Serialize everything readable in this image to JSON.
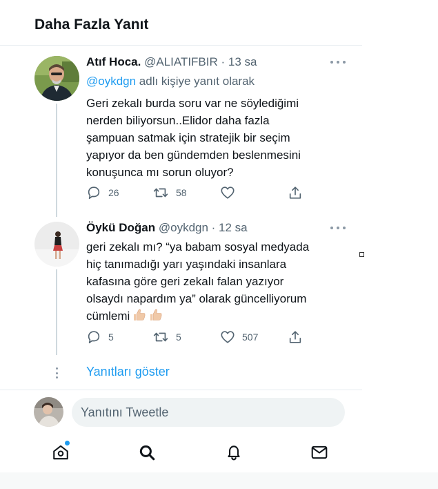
{
  "header": {
    "title": "Daha Fazla Yanıt"
  },
  "tweets": [
    {
      "name": "Atıf Hoca.",
      "meta": "@ALIATIFBIR · 13 sa",
      "reply_prefix": "@oykdgn",
      "reply_suffix": " adlı kişiye yanıt olarak",
      "lines": [
        "Geri zekalı burda soru var ne söylediğimi",
        "nerden biliyorsun..Elidor daha fazla",
        "şampuan satmak için stratejik bir seçim",
        "yapıyor da ben gündemden beslenmesini",
        "konuşunca mı sorun oluyor?"
      ],
      "replies": "26",
      "retweets": "58",
      "likes": ""
    },
    {
      "name": "Öykü Doğan",
      "meta": "@oykdgn · 12 sa",
      "lines": [
        "geri zekalı mı? “ya babam sosyal medyada",
        "hiç tanımadığı yarı yaşındaki insanlara",
        "kafasına göre geri zekalı falan yazıyor",
        "olsaydı napardım ya” olarak güncelliyorum",
        "cümlemi"
      ],
      "emoji": "thumbs-up-light-skin x2",
      "replies": "5",
      "retweets": "5",
      "likes": "507"
    }
  ],
  "show_replies": "Yanıtları göster",
  "compose": {
    "placeholder": "Yanıtını Tweetle"
  },
  "nav": [
    "home-icon",
    "search-icon",
    "notifications-icon",
    "messages-icon"
  ],
  "colors": {
    "accent": "#1d9bf0",
    "text": "#0f1419",
    "muted": "#536471",
    "border": "#e6ecf0"
  }
}
